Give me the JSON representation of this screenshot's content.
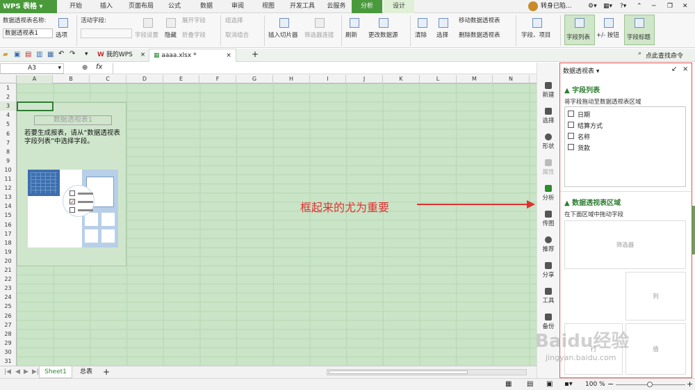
{
  "app": {
    "name": "WPS 表格"
  },
  "menu_tabs": [
    "开始",
    "插入",
    "页面布局",
    "公式",
    "数据",
    "审阅",
    "视图",
    "开发工具",
    "云服务",
    "分析",
    "设计"
  ],
  "active_tab": "分析",
  "user": {
    "name": "转身已陷..."
  },
  "ribbon": {
    "pivot_name_label": "数据透视表名称:",
    "pivot_name_value": "数据透视表1",
    "options_label": "选项",
    "active_field_label": "活动字段:",
    "field_settings": "字段设置",
    "hide": "隐藏",
    "expand_field": "展开字段",
    "collapse_field": "折叠字段",
    "group_select": "组选择",
    "ungroup": "取消组合",
    "insert_slicer": "插入切片器",
    "filter_connection": "筛选器连接",
    "refresh": "刷新",
    "change_source": "更改数据源",
    "clear": "清除",
    "select": "选择",
    "move_pivot": "移动数据透视表",
    "delete_pivot": "删除数据透视表",
    "fields_items": "字段、项目",
    "field_list": "字段列表",
    "buttons": "+/- 按钮",
    "field_headers": "字段标题"
  },
  "qbar": {
    "my_wps": "我的WPS",
    "file_tab": "aaaa.xlsx *",
    "search_cmd": "点此查找命令"
  },
  "formula": {
    "cell_ref": "A3",
    "fx": "fx",
    "value": ""
  },
  "columns": [
    "A",
    "B",
    "C",
    "D",
    "E",
    "F",
    "G",
    "H",
    "I",
    "J",
    "K",
    "L",
    "M",
    "N"
  ],
  "rows": [
    "1",
    "2",
    "3",
    "4",
    "5",
    "6",
    "7",
    "8",
    "9",
    "10",
    "11",
    "12",
    "13",
    "14",
    "15",
    "16",
    "17",
    "18",
    "19",
    "20",
    "21",
    "22",
    "23",
    "24",
    "25",
    "26",
    "27",
    "28",
    "29",
    "30",
    "31"
  ],
  "placeholder": {
    "title": "数据透视表1",
    "text": "若要生成报表，请从“数据透视表字段列表”中选择字段。"
  },
  "annotation": {
    "text": "框起来的尤为重要",
    "color": "#e03030"
  },
  "sheets": [
    "Sheet1",
    "总表"
  ],
  "active_sheet": "Sheet1",
  "side_toolbar": [
    "新建",
    "选择",
    "形状",
    "属性",
    "分析",
    "传图",
    "推荐",
    "分享",
    "工具",
    "备份"
  ],
  "pane": {
    "title": "数据透视表",
    "field_list_header": "字段列表",
    "drag_hint": "将字段拖动至数据透视表区域",
    "fields": [
      "日期",
      "结算方式",
      "名称",
      "货款"
    ],
    "areas_header": "数据透视表区域",
    "areas_hint": "在下面区域中拖动字段",
    "filter_label": "筛选器",
    "col_label": "列",
    "row_label": "行",
    "values_label": "值"
  },
  "status": {
    "zoom": "100 %"
  },
  "watermark": {
    "text": "Baidu经验",
    "sub": "jingyan.baidu.com"
  }
}
